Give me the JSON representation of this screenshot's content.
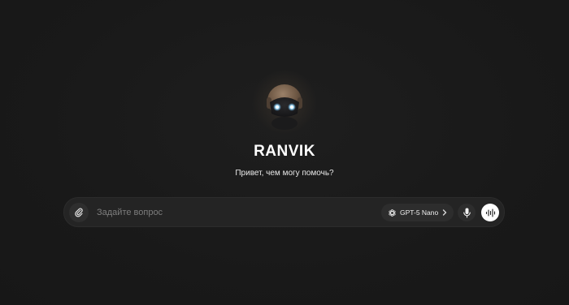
{
  "hero": {
    "title": "RANVIK",
    "subtitle": "Привет, чем могу помочь?"
  },
  "composer": {
    "placeholder": "Задайте вопрос",
    "value": "",
    "model_label": "GPT-5 Nano",
    "icons": {
      "attach": "paperclip-icon",
      "model": "openai-logo-icon",
      "chevron": "chevron-right-icon",
      "mic": "microphone-icon",
      "voice": "voice-waveform-icon"
    }
  },
  "colors": {
    "background": "#1a1a1a",
    "composer": "#242424",
    "button": "#2d2d2d",
    "voice_button": "#ffffff",
    "accent_eyes": "#8fd4ff",
    "avatar_head": "#7a6450"
  }
}
